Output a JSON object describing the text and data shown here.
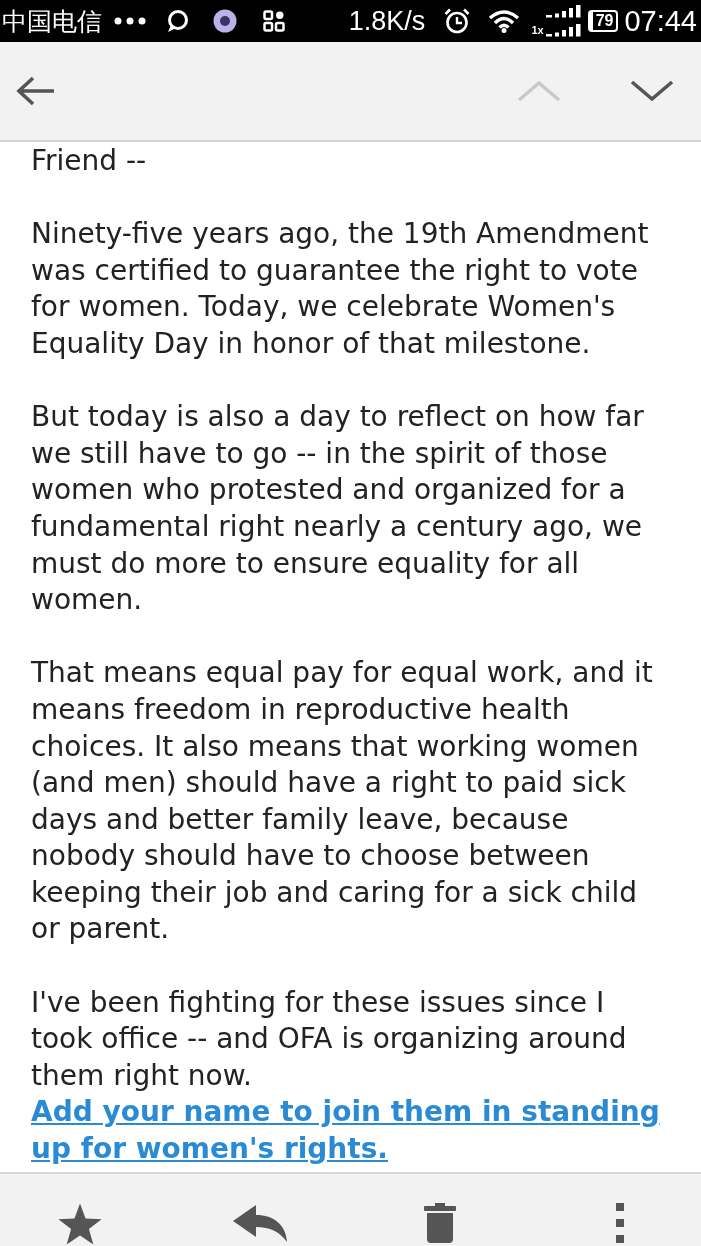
{
  "status_bar": {
    "carrier": "中国电信",
    "network_speed": "1.8K/s",
    "signal_label": "1x",
    "battery": "79",
    "time": "07:44"
  },
  "toolbar": {
    "buttons": [
      {
        "kind": "back",
        "disabled": false
      },
      {
        "kind": "previous",
        "disabled": true
      },
      {
        "kind": "next",
        "disabled": false
      }
    ]
  },
  "message": {
    "paragraphs": [
      {
        "text": "Friend --"
      },
      {
        "text": "Ninety-five years ago, the 19th Amendment was certified to guarantee the right to vote for women. Today, we celebrate Women's Equality Day in honor of that milestone."
      },
      {
        "text": "But today is also a day to reflect on how far we still have to go -- in the spirit of those women who protested and organized for a fundamental right nearly a century ago, we must do more to ensure equality for all women."
      },
      {
        "text": "That means equal pay for equal work, and it means freedom in reproductive health choices. It also means that working women (and men) should have a right to paid sick days and better family leave, because nobody should have to choose between keeping their job and caring for a sick child or parent."
      },
      {
        "text": "I've been fighting for these issues since I took office -- and OFA is organizing around them right now.",
        "link": "Add your name to join them in standing up for women's rights."
      }
    ]
  },
  "bottom_bar": {
    "actions": [
      {
        "kind": "star"
      },
      {
        "kind": "reply"
      },
      {
        "kind": "delete"
      },
      {
        "kind": "more"
      }
    ]
  }
}
